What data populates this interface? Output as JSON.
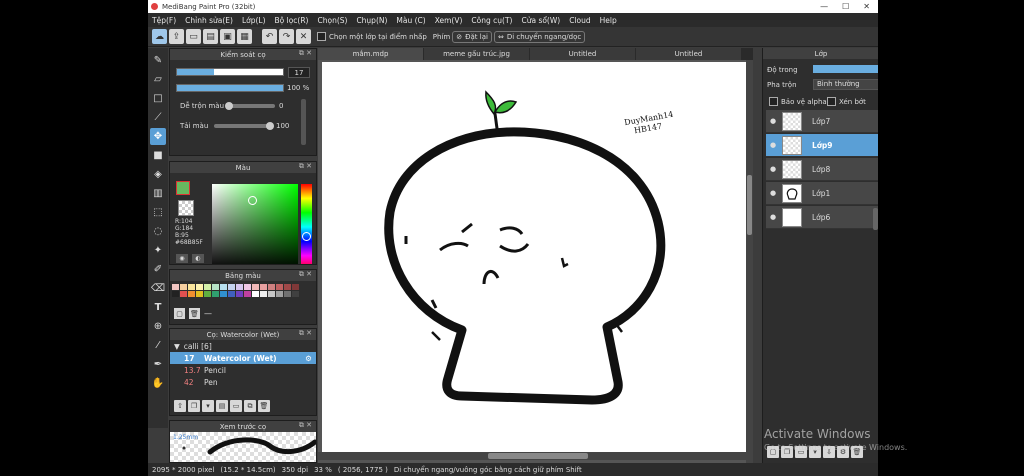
{
  "titlebar": {
    "title": "MediBang Paint Pro (32bit)",
    "minimize": "—",
    "maximize": "☐",
    "close": "✕"
  },
  "menu": [
    "Tệp(F)",
    "Chỉnh sửa(E)",
    "Lớp(L)",
    "Bộ lọc(R)",
    "Chọn(S)",
    "Chụp(N)",
    "Màu (C)",
    "Xem(V)",
    "Công cụ(T)",
    "Cửa sổ(W)",
    "Cloud",
    "Help"
  ],
  "toolbar": {
    "select_label": "Chọn một lớp tại điểm nhấp",
    "snap_label": "Phím",
    "reset_label": "Đặt lại",
    "move_label": "Di chuyển ngang/dọc"
  },
  "brush_control": {
    "title": "Kiểm soát cọ",
    "size_value": "17",
    "opacity_value": "100 %",
    "size_fraction": 0.35,
    "opacity_fraction": 1.0,
    "mix_label": "Dễ trộn màu",
    "mix_value": "0",
    "mix_fraction": 0.0,
    "reload_label": "Tải màu",
    "reload_value": "100",
    "reload_fraction": 1.0
  },
  "color": {
    "title": "Màu",
    "current_hex": "#68B85F",
    "r": "R:104",
    "g": "G:184",
    "b": "B:95",
    "hex_label": "#68B85F"
  },
  "palette": {
    "title": "Bảng màu",
    "colors": [
      "#f4c7c3",
      "#f8d0a0",
      "#fbe59b",
      "#fff3b0",
      "#d4f0a8",
      "#b6e3c6",
      "#b7e0f0",
      "#c5d3f0",
      "#d7c7f0",
      "#f0c7e6",
      "#f2b8b8",
      "#e8a0a0",
      "#d08080",
      "#c06060",
      "#a04848",
      "#803838",
      "#222222",
      "#e05050",
      "#f09030",
      "#e0c020",
      "#60b040",
      "#30a070",
      "#3090d0",
      "#4060c0",
      "#7040c0",
      "#c040a0",
      "#ffffff",
      "#f0f0f0",
      "#c8c8c8",
      "#a0a0a0",
      "#707070",
      "#404040"
    ],
    "extra": "—"
  },
  "brush_list": {
    "title": "Cọ: Watercolor (Wet)",
    "group": "calli [6]",
    "items": [
      {
        "size": "17",
        "name": "Watercolor (Wet)",
        "selected": true
      },
      {
        "size": "13.7",
        "name": "Pencil",
        "selected": false
      },
      {
        "size": "42",
        "name": "Pen",
        "selected": false
      }
    ]
  },
  "brush_preview": {
    "title": "Xem trước cọ",
    "size": "1.25mm"
  },
  "tabs": [
    "mắm.mdp",
    "meme gấu trúc.jpg",
    "Untitled",
    "Untitled"
  ],
  "canvas": {
    "signature_line1": "DuyManh14",
    "signature_line2": "HB147"
  },
  "layers": {
    "title": "Lớp",
    "opacity_label": "Độ trong",
    "blend_label": "Pha trộn",
    "blend_value": "Bình thường",
    "protect_label": "Bảo vệ alpha",
    "clip_label": "Xén bớt",
    "items": [
      {
        "name": "Lớp7",
        "selected": false
      },
      {
        "name": "Lớp9",
        "selected": true
      },
      {
        "name": "Lớp8",
        "selected": false
      },
      {
        "name": "Lớp1",
        "selected": false
      },
      {
        "name": "Lớp6",
        "selected": false
      }
    ]
  },
  "status": {
    "size": "2095 * 2000 pixel",
    "physical": "(15.2 * 14.5cm)",
    "dpi": "350 dpi",
    "zoom": "33 %",
    "coords": "( 2056, 1775 )",
    "hint": "Di chuyển ngang/vuông góc bằng cách giữ phím Shift"
  },
  "watermark": {
    "line1": "Activate Windows",
    "line2": "Go to Settings to activate Windows."
  }
}
